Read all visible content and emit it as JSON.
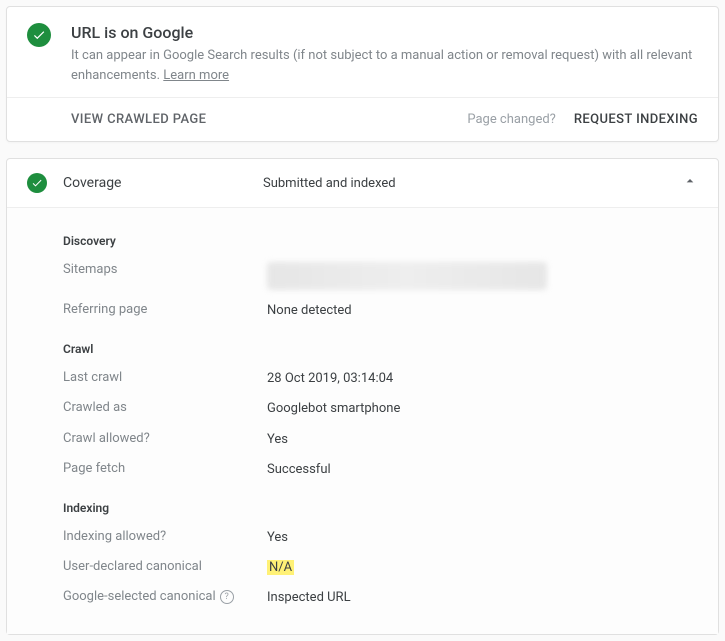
{
  "status": {
    "title": "URL is on Google",
    "desc_prefix": "It can appear in Google Search results (if not subject to a manual action or removal request) with all relevant enhancements. ",
    "learn_more": "Learn more"
  },
  "actions": {
    "view_crawled": "VIEW CRAWLED PAGE",
    "page_changed": "Page changed?",
    "request_indexing": "REQUEST INDEXING"
  },
  "coverage": {
    "label": "Coverage",
    "status": "Submitted and indexed",
    "sections": {
      "discovery": {
        "title": "Discovery",
        "sitemaps_label": "Sitemaps",
        "referring_label": "Referring page",
        "referring_value": "None detected"
      },
      "crawl": {
        "title": "Crawl",
        "last_crawl_label": "Last crawl",
        "last_crawl_value": "28 Oct 2019, 03:14:04",
        "crawled_as_label": "Crawled as",
        "crawled_as_value": "Googlebot smartphone",
        "crawl_allowed_label": "Crawl allowed?",
        "crawl_allowed_value": "Yes",
        "page_fetch_label": "Page fetch",
        "page_fetch_value": "Successful"
      },
      "indexing": {
        "title": "Indexing",
        "allowed_label": "Indexing allowed?",
        "allowed_value": "Yes",
        "user_canonical_label": "User-declared canonical",
        "user_canonical_value": "N/A",
        "google_canonical_label": "Google-selected canonical",
        "google_canonical_value": "Inspected URL"
      }
    }
  }
}
